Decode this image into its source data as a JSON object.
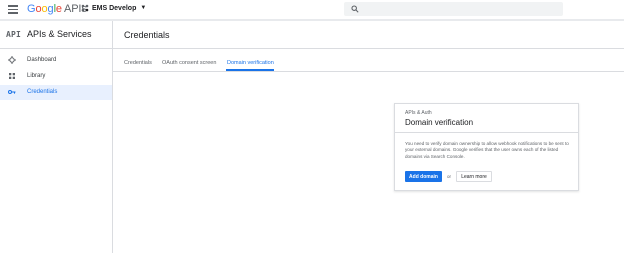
{
  "header": {
    "logo_word": "Google",
    "logo_suffix": "APIs",
    "project_name": "EMS Develop",
    "search_placeholder": ""
  },
  "sidebar": {
    "badge": "API",
    "title": "APIs & Services",
    "items": [
      {
        "label": "Dashboard",
        "icon": "dashboard-icon"
      },
      {
        "label": "Library",
        "icon": "library-icon"
      },
      {
        "label": "Credentials",
        "icon": "key-icon",
        "active": true
      }
    ]
  },
  "main": {
    "title": "Credentials",
    "tabs": [
      {
        "label": "Credentials"
      },
      {
        "label": "OAuth consent screen"
      },
      {
        "label": "Domain verification",
        "active": true
      }
    ]
  },
  "card": {
    "kicker": "APIs & Auth",
    "title": "Domain verification",
    "body": "You need to verify domain ownership to allow webhook notifications to be sent to your external domains. Google verifies that the user owns each of the listed domains via Search Console.",
    "primary_label": "Add domain",
    "or_label": "or",
    "secondary_label": "Learn more"
  },
  "colors": {
    "accent": "#1a73e8",
    "active_bg": "#e8f0fe",
    "border": "#dadce0"
  }
}
